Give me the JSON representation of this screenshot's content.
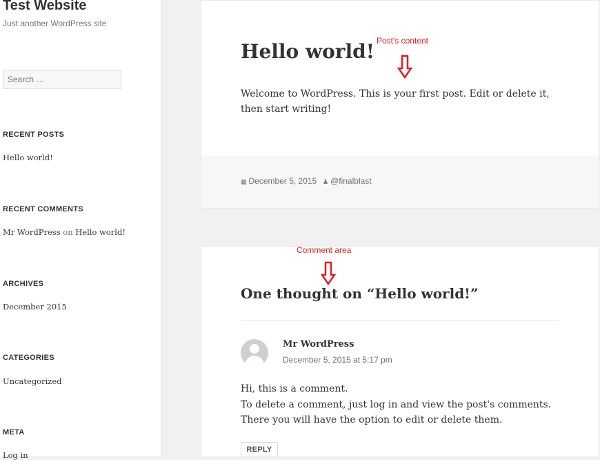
{
  "sidebar": {
    "site_title": "Test Website",
    "site_description": "Just another WordPress site",
    "search_placeholder": "Search …",
    "recent_posts": {
      "title": "RECENT POSTS",
      "items": [
        "Hello world!"
      ]
    },
    "recent_comments": {
      "title": "RECENT COMMENTS",
      "author": "Mr WordPress",
      "on": "on",
      "post": "Hello world!"
    },
    "archives": {
      "title": "ARCHIVES",
      "items": [
        "December 2015"
      ]
    },
    "categories": {
      "title": "CATEGORIES",
      "items": [
        "Uncategorized"
      ]
    },
    "meta": {
      "title": "META",
      "items": [
        "Log in"
      ]
    }
  },
  "post": {
    "title": "Hello world!",
    "content": "Welcome to WordPress. This is your first post. Edit or delete it, then start writing!",
    "date": "December 5, 2015",
    "author": "@finalblast"
  },
  "comments": {
    "title": "One thought on “Hello world!”",
    "items": [
      {
        "author": "Mr WordPress",
        "date": "December 5, 2015 at 5:17 pm",
        "line1": "Hi, this is a comment.",
        "line2": "To delete a comment, just log in and view the post's comments. There you will have the option to edit or delete them.",
        "reply_label": "REPLY"
      }
    ]
  },
  "annotations": {
    "post_content_label": "Post's content",
    "comment_area_label": "Comment area",
    "color": "#e51c23"
  },
  "icons": {
    "calendar": "calendar-icon",
    "user": "user-icon",
    "arrow": "arrow-down-icon"
  }
}
